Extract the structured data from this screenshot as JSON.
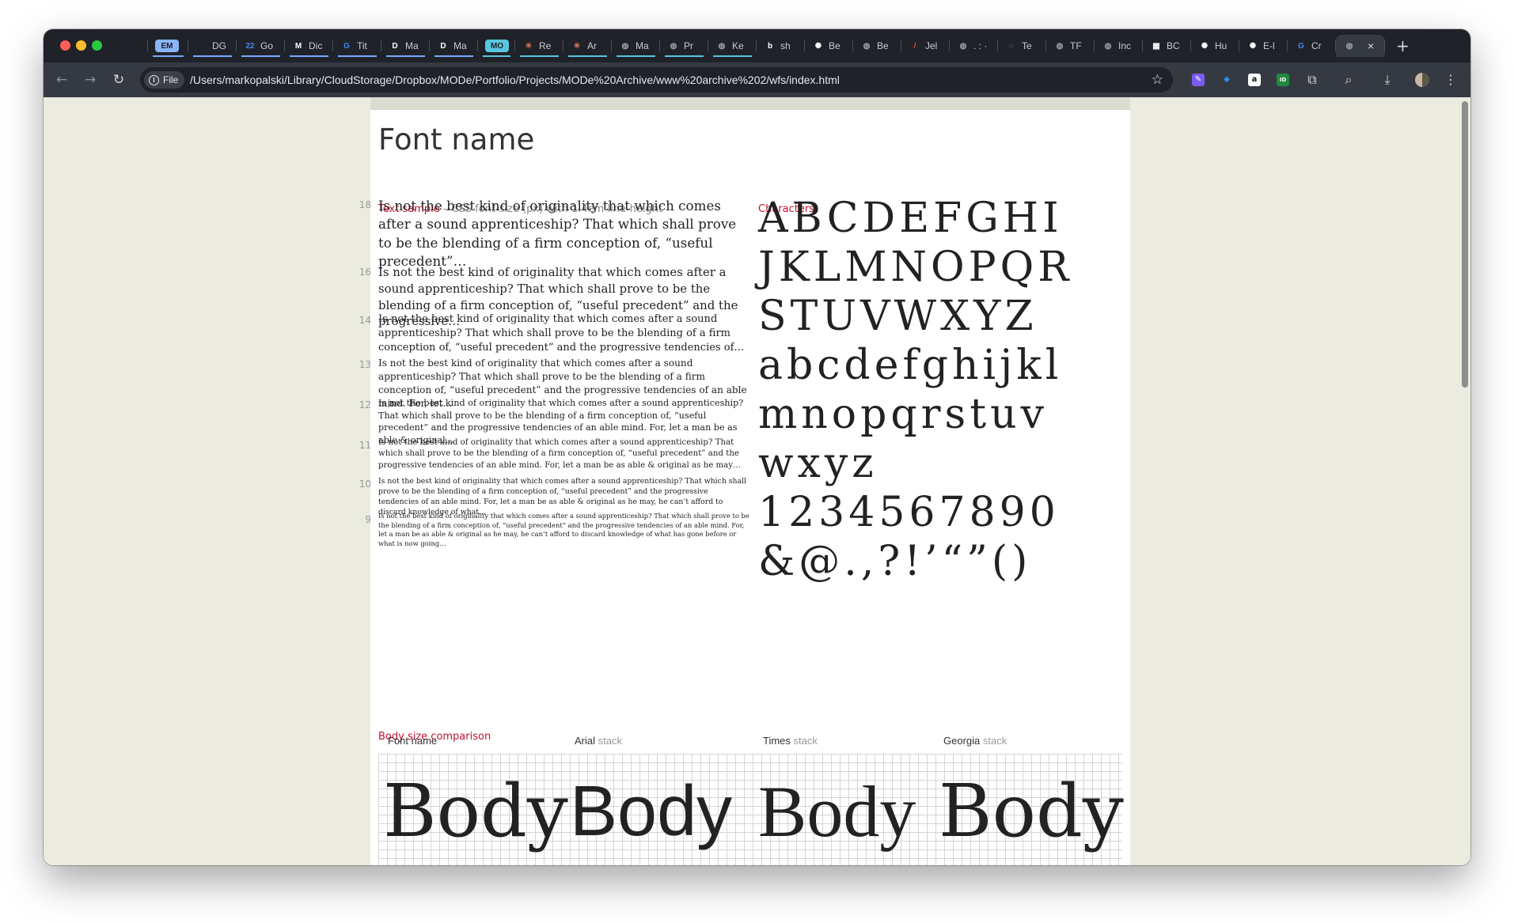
{
  "browser": {
    "tabs": [
      {
        "label": "",
        "icon": "sketch-gem-icon",
        "color": "#2d8cf0",
        "text": ""
      },
      {
        "label": "",
        "icon": "em-group-chip",
        "color": "#8ab4f8",
        "text": "EM"
      },
      {
        "label": "DG",
        "icon": "dg-icon",
        "color": "#ffffff",
        "text": ""
      },
      {
        "label": "Go",
        "icon": "calendar-icon",
        "color": "#4285f4",
        "text": "22"
      },
      {
        "label": "Dic",
        "icon": "gmail-icon",
        "color": "#ffffff",
        "text": "M"
      },
      {
        "label": "Tit",
        "icon": "google-g-icon",
        "color": "#4285f4",
        "text": "G"
      },
      {
        "label": "Ma",
        "icon": "d-icon",
        "color": "#ffffff",
        "text": "D"
      },
      {
        "label": "Ma",
        "icon": "d-icon",
        "color": "#ffffff",
        "text": "D"
      },
      {
        "label": "",
        "icon": "mo-group-chip",
        "color": "#58c6de",
        "text": "MO"
      },
      {
        "label": "Re",
        "icon": "claude-icon",
        "color": "#d97757",
        "text": "✳"
      },
      {
        "label": "Ar",
        "icon": "claude-icon",
        "color": "#d97757",
        "text": "✳"
      },
      {
        "label": "Ma",
        "icon": "globe-icon",
        "color": "#9aa0a6",
        "text": "◍"
      },
      {
        "label": "Pr",
        "icon": "globe-icon",
        "color": "#9aa0a6",
        "text": "◍"
      },
      {
        "label": "Ke",
        "icon": "globe-icon",
        "color": "#9aa0a6",
        "text": "◍"
      },
      {
        "label": "sh",
        "icon": "b-icon",
        "color": "#ffffff",
        "text": "b"
      },
      {
        "label": "Be",
        "icon": "openai-icon",
        "color": "#ffffff",
        "text": "✺"
      },
      {
        "label": "Be",
        "icon": "globe-icon",
        "color": "#9aa0a6",
        "text": "◍"
      },
      {
        "label": "Jel",
        "icon": "pencil-icon",
        "color": "#e8453c",
        "text": "/"
      },
      {
        "label": ". : ·",
        "icon": "globe-icon",
        "color": "#9aa0a6",
        "text": "◍"
      },
      {
        "label": "Te",
        "icon": "spinner-icon",
        "color": "#9aa0a6",
        "text": "◌"
      },
      {
        "label": "TF",
        "icon": "globe-icon",
        "color": "#9aa0a6",
        "text": "◍"
      },
      {
        "label": "Inc",
        "icon": "globe-icon",
        "color": "#9aa0a6",
        "text": "◍"
      },
      {
        "label": "BC",
        "icon": "bc-icon",
        "color": "#ffffff",
        "text": "▦"
      },
      {
        "label": "Hu",
        "icon": "openai-icon",
        "color": "#ffffff",
        "text": "✺"
      },
      {
        "label": "E-l",
        "icon": "openai-icon",
        "color": "#ffffff",
        "text": "✺"
      },
      {
        "label": "Cr",
        "icon": "google-g-icon",
        "color": "#4285f4",
        "text": "G"
      },
      {
        "label": "",
        "icon": "globe-icon",
        "color": "#9aa0a6",
        "text": "◍",
        "active": true
      }
    ],
    "url_chip": "File",
    "url": "/Users/markopalski/Library/CloudStorage/Dropbox/MODe/Portfolio/Projects/MODe%20Archive/www%20archive%202/wfs/index.html"
  },
  "page": {
    "title": "Font name",
    "text_sample_label": "Text sample",
    "text_sample_note": " – CSS font-size (px) with 1.4em line-height",
    "characters_label": "Characters",
    "samples": [
      {
        "size": "18",
        "text": "Is not the best kind of originality that which comes after a sound apprenticeship? That which shall prove to be the blending of a firm conception of, “useful precedent”…"
      },
      {
        "size": "16",
        "text": "Is not the best kind of originality that which comes after a sound apprenticeship? That which shall prove to be the blending of a firm conception of, “useful precedent” and the progressive…"
      },
      {
        "size": "14",
        "text": "Is not the best kind of originality that which comes after a sound apprenticeship? That which shall prove to be the blending of a firm conception of, “useful precedent” and the progressive tendencies of…"
      },
      {
        "size": "13",
        "text": "Is not the best kind of originality that which comes after a sound apprenticeship? That which shall prove to be the blending of a firm conception of, “useful precedent” and the progressive tendencies of an able mind. For, let…"
      },
      {
        "size": "12",
        "text": "Is not the best kind of originality that which comes after a sound apprenticeship? That which shall prove to be the blending of a firm conception of, “useful precedent” and the progressive tendencies of an able mind. For, let a man be as able & original…"
      },
      {
        "size": "11",
        "text": "Is not the best kind of originality that which comes after a sound apprenticeship? That which shall prove to be the blending of a firm conception of, “useful precedent” and the progressive tendencies of an able mind. For, let a man be as able & original as he may…"
      },
      {
        "size": "10",
        "text": "Is not the best kind of originality that which comes after a sound apprenticeship? That which shall prove to be the blending of a firm conception of, “useful precedent” and the progressive tendencies of an able mind. For, let a man be as able & original as he may, he can’t afford to discard knowledge of what…"
      },
      {
        "size": "9",
        "text": "Is not the best kind of originality that which comes after a sound apprenticeship? That which shall prove to be the blending of a firm conception of, “useful precedent” and the progressive tendencies of an able mind. For, let a man be as able & original as he may, he can’t afford to discard knowledge of what has gone before or what is now going…"
      }
    ],
    "characters": [
      "ABCDEFGHI",
      "JKLMNOPQR",
      "STUVWXYZ",
      "abcdefghijkl",
      "mnopqrstuv",
      "wxyz",
      "1234567890",
      "&@.,?!’“”()"
    ],
    "body_comparison_label": "Body size comparison",
    "comparison": [
      {
        "name": "Font name",
        "stack": "",
        "word": "Body"
      },
      {
        "name": "Arial",
        "stack": " stack",
        "word": "Body"
      },
      {
        "name": "Times",
        "stack": " stack",
        "word": "Body"
      },
      {
        "name": "Georgia",
        "stack": " stack",
        "word": "Body"
      }
    ]
  }
}
